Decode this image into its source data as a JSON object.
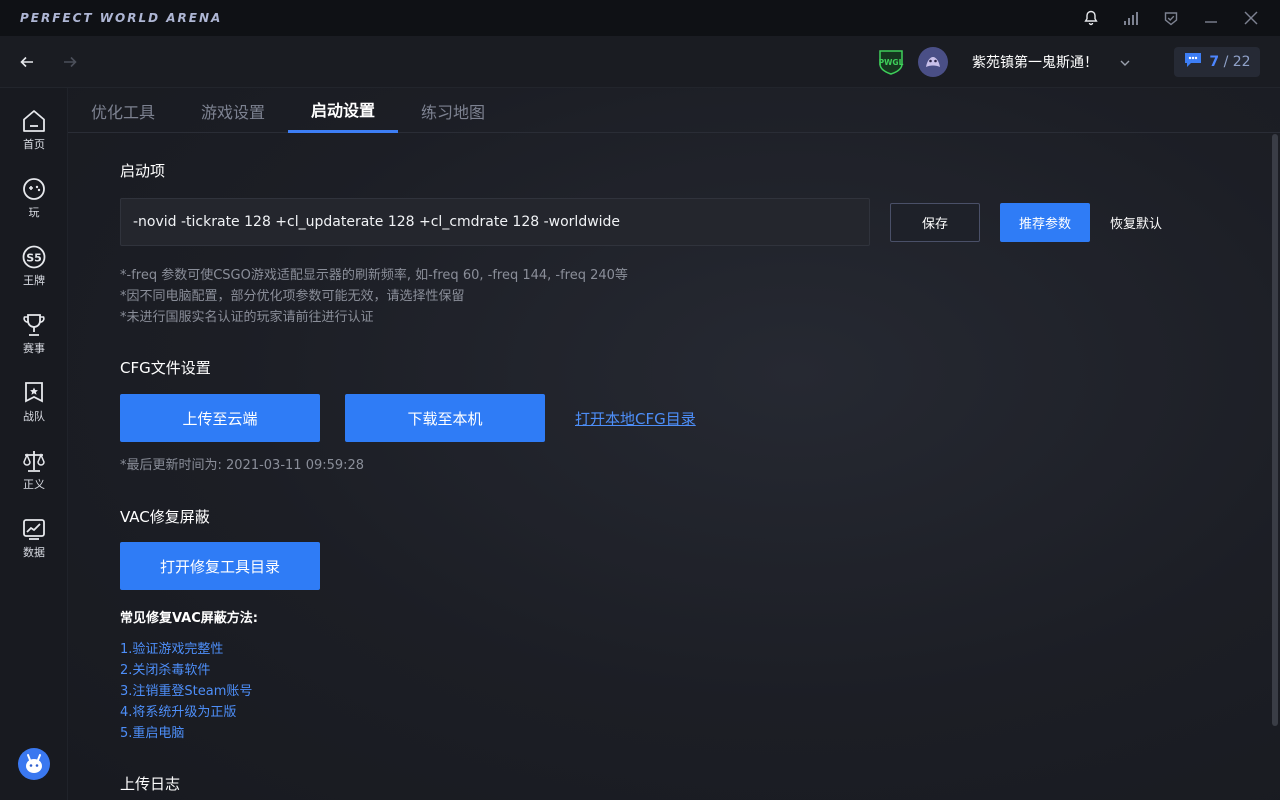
{
  "app": {
    "title": "PERFECT WORLD ARENA"
  },
  "header": {
    "username": "紫苑镇第一鬼斯通！",
    "badge_text": "PWGL",
    "msg_current": "7",
    "msg_total": " / 22"
  },
  "sidebar": {
    "items": [
      {
        "label": "首页",
        "icon": "home-icon"
      },
      {
        "label": "玩",
        "icon": "gamepad-icon"
      },
      {
        "label": "王牌",
        "icon": "s5-icon"
      },
      {
        "label": "赛事",
        "icon": "trophy-icon"
      },
      {
        "label": "战队",
        "icon": "team-flag-icon"
      },
      {
        "label": "正义",
        "icon": "scales-icon"
      },
      {
        "label": "数据",
        "icon": "chart-icon"
      }
    ]
  },
  "tabs": [
    {
      "label": "优化工具",
      "active": false
    },
    {
      "label": "游戏设置",
      "active": false
    },
    {
      "label": "启动设置",
      "active": true
    },
    {
      "label": "练习地图",
      "active": false
    }
  ],
  "launch": {
    "title": "启动项",
    "value": "-novid -tickrate 128 +cl_updaterate 128 +cl_cmdrate 128 -worldwide",
    "save_label": "保存",
    "recommend_label": "推荐参数",
    "reset_label": "恢复默认",
    "notes": [
      "*-freq 参数可使CSGO游戏适配显示器的刷新频率, 如-freq 60, -freq 144, -freq 240等",
      "*因不同电脑配置，部分优化项参数可能无效，请选择性保留",
      "*未进行国服实名认证的玩家请前往进行认证"
    ]
  },
  "cfg": {
    "title": "CFG文件设置",
    "upload_label": "上传至云端",
    "download_label": "下载至本机",
    "open_dir_label": "打开本地CFG目录",
    "last_update": "*最后更新时间为: 2021-03-11 09:59:28"
  },
  "vac": {
    "title": "VAC修复屏蔽",
    "open_tool_label": "打开修复工具目录",
    "methods_title": "常见修复VAC屏蔽方法:",
    "methods": [
      "1.验证游戏完整性",
      "2.关闭杀毒软件",
      "3.注销重登Steam账号",
      "4.将系统升级为正版",
      "5.重启电脑"
    ]
  },
  "upload_log": {
    "title": "上传日志"
  },
  "colors": {
    "accent": "#2f7cf6",
    "link": "#4d8ef8",
    "bg": "#14161b"
  }
}
